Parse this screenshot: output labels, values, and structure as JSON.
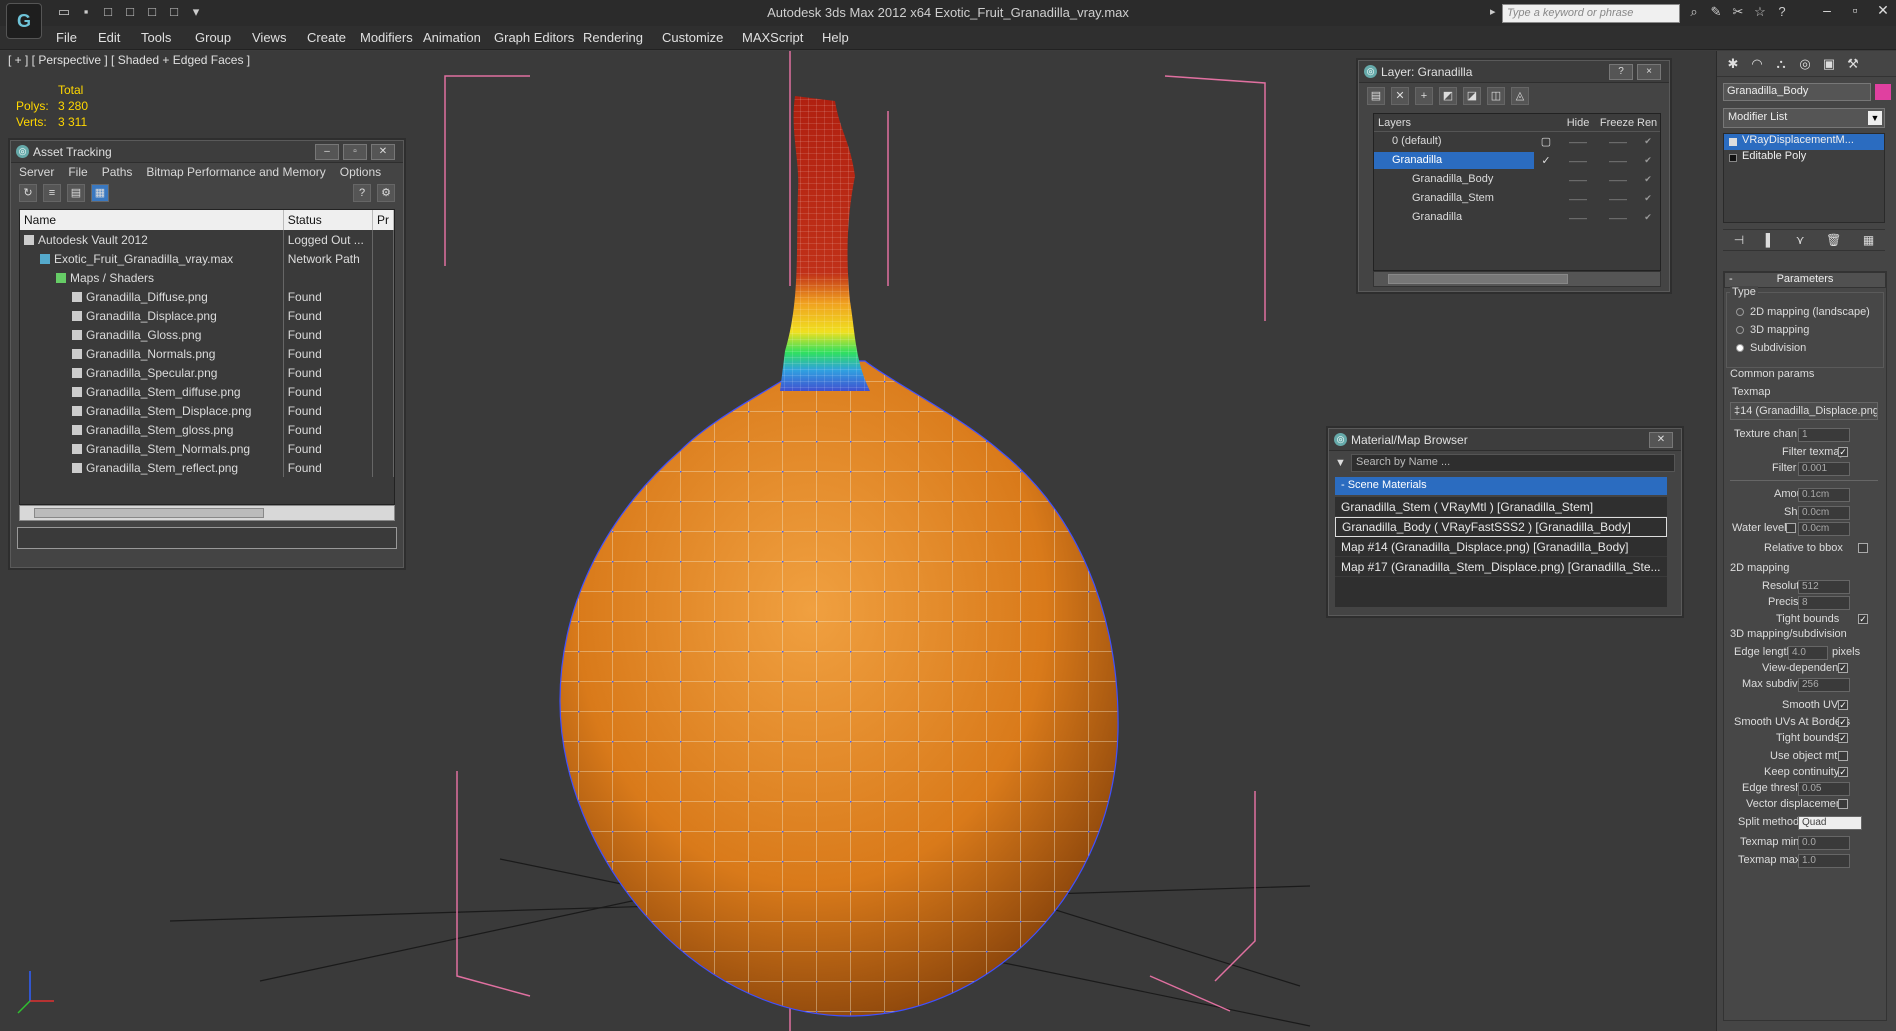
{
  "app": {
    "title": "Autodesk 3ds Max  2012 x64     Exotic_Fruit_Granadilla_vray.max",
    "search_placeholder": "Type a keyword or phrase",
    "logo_icon": "3dsmax-logo-icon"
  },
  "menu": [
    "File",
    "Edit",
    "Tools",
    "Group",
    "Views",
    "Create",
    "Modifiers",
    "Animation",
    "Graph Editors",
    "Rendering",
    "Customize",
    "MAXScript",
    "Help"
  ],
  "viewport": {
    "label": "[ + ] [ Perspective ] [ Shaded + Edged Faces ]",
    "stats": {
      "header": "Total",
      "polys_label": "Polys:",
      "polys": "3 280",
      "verts_label": "Verts:",
      "verts": "3 311"
    }
  },
  "asset_tracking": {
    "title": "Asset Tracking",
    "menu": [
      "Server",
      "File",
      "Paths",
      "Bitmap Performance and Memory",
      "Options"
    ],
    "columns": [
      "Name",
      "Status",
      "Pr"
    ],
    "rows": [
      {
        "name": "Autodesk Vault 2012",
        "status": "Logged Out ...",
        "indent": 1
      },
      {
        "name": "Exotic_Fruit_Granadilla_vray.max",
        "status": "Network Path",
        "indent": 2
      },
      {
        "name": "Maps / Shaders",
        "status": "",
        "indent": 3
      },
      {
        "name": "Granadilla_Diffuse.png",
        "status": "Found",
        "indent": 4
      },
      {
        "name": "Granadilla_Displace.png",
        "status": "Found",
        "indent": 4
      },
      {
        "name": "Granadilla_Gloss.png",
        "status": "Found",
        "indent": 4
      },
      {
        "name": "Granadilla_Normals.png",
        "status": "Found",
        "indent": 4
      },
      {
        "name": "Granadilla_Specular.png",
        "status": "Found",
        "indent": 4
      },
      {
        "name": "Granadilla_Stem_diffuse.png",
        "status": "Found",
        "indent": 4
      },
      {
        "name": "Granadilla_Stem_Displace.png",
        "status": "Found",
        "indent": 4
      },
      {
        "name": "Granadilla_Stem_gloss.png",
        "status": "Found",
        "indent": 4
      },
      {
        "name": "Granadilla_Stem_Normals.png",
        "status": "Found",
        "indent": 4
      },
      {
        "name": "Granadilla_Stem_reflect.png",
        "status": "Found",
        "indent": 4
      }
    ]
  },
  "layer": {
    "title": "Layer: Granadilla",
    "help": "?",
    "close": "×",
    "columns": [
      "Layers",
      "Hide",
      "Freeze",
      "Ren"
    ],
    "rows": [
      {
        "name": "0 (default)",
        "indent": 1,
        "selected": false
      },
      {
        "name": "Granadilla",
        "indent": 1,
        "selected": true
      },
      {
        "name": "Granadilla_Body",
        "indent": 2,
        "selected": false
      },
      {
        "name": "Granadilla_Stem",
        "indent": 2,
        "selected": false
      },
      {
        "name": "Granadilla",
        "indent": 2,
        "selected": false
      }
    ]
  },
  "material_browser": {
    "title": "Material/Map Browser",
    "search": "Search by Name ...",
    "section": "- Scene Materials",
    "items": [
      {
        "label": "Granadilla_Stem  ( VRayMtl )  [Granadilla_Stem]",
        "selected": false
      },
      {
        "label": "Granadilla_Body  ( VRayFastSSS2 )  [Granadilla_Body]",
        "selected": true
      },
      {
        "label": "Map #14 (Granadilla_Displace.png)  [Granadilla_Body]",
        "selected": false
      },
      {
        "label": "Map #17 (Granadilla_Stem_Displace.png)  [Granadilla_Ste...",
        "selected": false
      }
    ]
  },
  "command_panel": {
    "object_name": "Granadilla_Body",
    "object_color": "#e040a0",
    "modifier_list": "Modifier List",
    "stack": [
      "VRayDisplacementM...",
      "Editable Poly"
    ],
    "rollout_title": "Parameters",
    "type_label": "Type",
    "types": [
      "2D mapping (landscape)",
      "3D mapping",
      "Subdivision"
    ],
    "type_selected": 2,
    "common_label": "Common params",
    "texmap_label": "Texmap",
    "texmap": "‡14 (Granadilla_Displace.png)",
    "texture_chan_label": "Texture chan",
    "texture_chan": "1",
    "filter_texmap_label": "Filter texmap",
    "filter_blur_label": "Filter blur",
    "filter_blur": "0.001",
    "amount_label": "Amount",
    "amount": "0.1cm",
    "shift_label": "Shift",
    "shift": "0.0cm",
    "water_label": "Water level",
    "water": "0.0cm",
    "relative_label": "Relative to bbox",
    "map2d_label": "2D mapping",
    "resolution_label": "Resolution",
    "resolution": "512",
    "precision_label": "Precision",
    "precision": "8",
    "tight_label": "Tight bounds",
    "map3d_label": "3D mapping/subdivision",
    "edge_len_label": "Edge length",
    "edge_len": "4.0",
    "pixels": "pixels",
    "view_dep_label": "View-dependent",
    "max_subdivs_label": "Max subdivs",
    "max_subdivs": "256",
    "smooth_uvs_label": "Smooth UVs",
    "smooth_uvs_borders_label": "Smooth UVs At Borders",
    "tight2_label": "Tight bounds",
    "use_obj_label": "Use object mtl",
    "keep_cont_label": "Keep continuity",
    "edge_thresh_label": "Edge thresh",
    "edge_thresh": "0.05",
    "vector_disp_label": "Vector displacement",
    "split_label": "Split method:",
    "split": "Quad",
    "texmap_min_label": "Texmap min:",
    "texmap_min": "0.0",
    "texmap_max_label": "Texmap max:",
    "texmap_max": "1.0"
  }
}
